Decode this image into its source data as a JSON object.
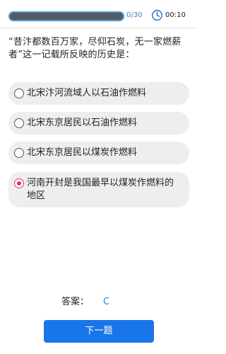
{
  "header": {
    "progress_text": "0/30",
    "progress_fraction": 0.0,
    "timer": "00:10",
    "timer_icon": "clock-icon"
  },
  "question": {
    "text": "“昔汴都数百万家，尽仰石炭，无一家燃薪者”这一记载所反映的历史是："
  },
  "options": [
    {
      "label": "北宋汴河流域人以石油作燃料",
      "selected": false
    },
    {
      "label": "北宋东京居民以石油作燃料",
      "selected": false
    },
    {
      "label": "北宋东京居民以煤炭作燃料",
      "selected": false
    },
    {
      "label": "河南开封是我国最早以煤炭作燃料的地区",
      "selected": true
    }
  ],
  "answer": {
    "label": "答案：",
    "value": "C"
  },
  "next_button_label": "下一题",
  "colors": {
    "accent": "#1976e8",
    "selected_radio": "#e2336b",
    "option_bg": "#eeeeee",
    "answer_value": "#1e88e5"
  }
}
